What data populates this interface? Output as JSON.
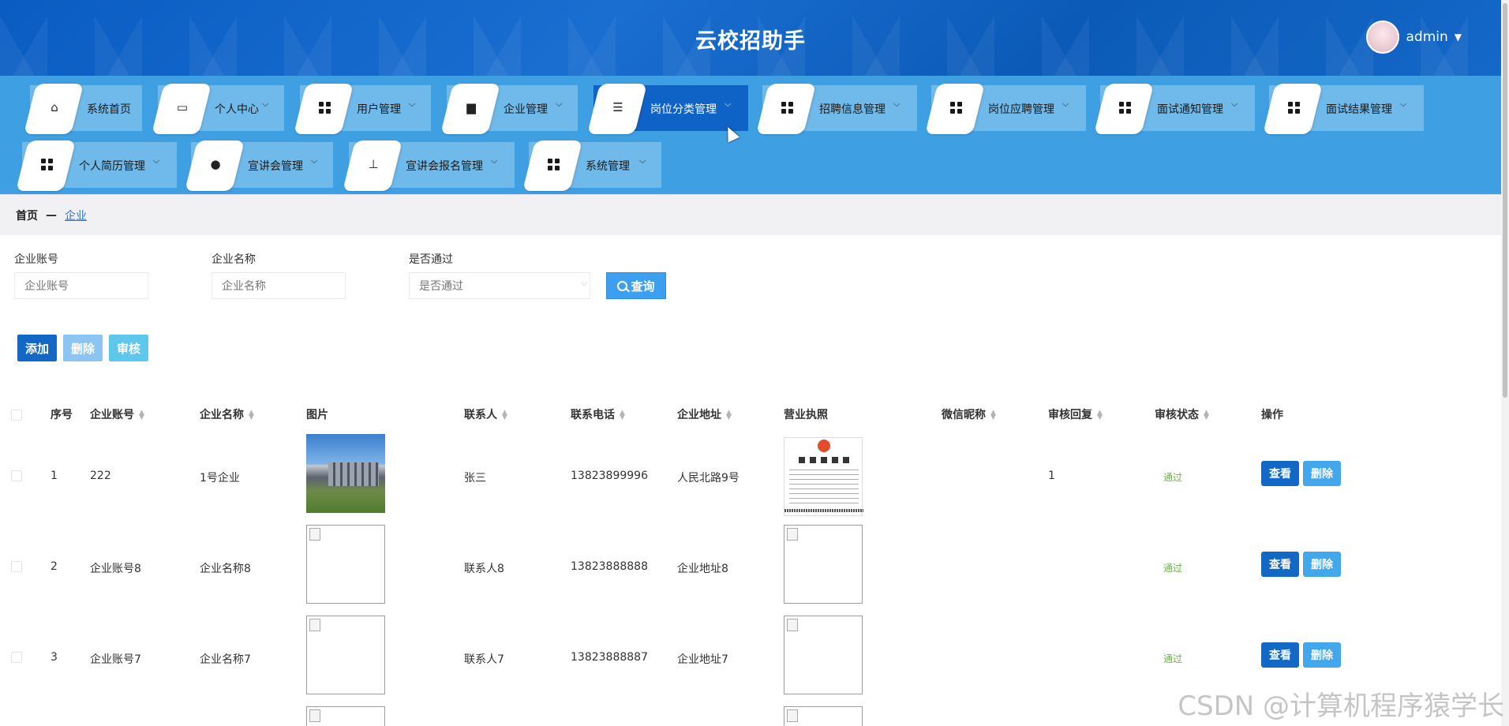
{
  "header": {
    "title": "云校招助手",
    "user_name": "admin"
  },
  "nav": {
    "items": [
      {
        "label": "系统首页",
        "icon": "home-icon",
        "has_dropdown": false,
        "active": false
      },
      {
        "label": "个人中心",
        "icon": "wallet-icon",
        "has_dropdown": true,
        "active": false
      },
      {
        "label": "用户管理",
        "icon": "grid-icon",
        "has_dropdown": true,
        "active": false
      },
      {
        "label": "企业管理",
        "icon": "store-icon",
        "has_dropdown": true,
        "active": false
      },
      {
        "label": "岗位分类管理",
        "icon": "sliders-icon",
        "has_dropdown": true,
        "active": true
      },
      {
        "label": "招聘信息管理",
        "icon": "grid-icon",
        "has_dropdown": true,
        "active": false
      },
      {
        "label": "岗位应聘管理",
        "icon": "grid-icon",
        "has_dropdown": true,
        "active": false
      },
      {
        "label": "面试通知管理",
        "icon": "grid-icon",
        "has_dropdown": true,
        "active": false
      },
      {
        "label": "面试结果管理",
        "icon": "grid-icon",
        "has_dropdown": true,
        "active": false
      },
      {
        "label": "个人简历管理",
        "icon": "grid-icon",
        "has_dropdown": true,
        "active": false
      },
      {
        "label": "宣讲会管理",
        "icon": "user-icon",
        "has_dropdown": true,
        "active": false
      },
      {
        "label": "宣讲会报名管理",
        "icon": "stamp-icon",
        "has_dropdown": true,
        "active": false
      },
      {
        "label": "系统管理",
        "icon": "grid-icon",
        "has_dropdown": true,
        "active": false
      }
    ]
  },
  "breadcrumb": {
    "home": "首页",
    "separator": "—",
    "current": "企业"
  },
  "search": {
    "account_label": "企业账号",
    "account_placeholder": "企业账号",
    "name_label": "企业名称",
    "name_placeholder": "企业名称",
    "passed_label": "是否通过",
    "passed_placeholder": "是否通过",
    "button_label": "查询"
  },
  "actions": {
    "add": "添加",
    "delete": "删除",
    "review": "审核"
  },
  "table": {
    "headers": {
      "index": "序号",
      "account": "企业账号",
      "name": "企业名称",
      "image": "图片",
      "contact": "联系人",
      "phone": "联系电话",
      "address": "企业地址",
      "license": "营业执照",
      "wechat": "微信昵称",
      "reply": "审核回复",
      "status": "审核状态",
      "ops": "操作"
    },
    "rows": [
      {
        "index": "1",
        "account": "222",
        "name": "1号企业",
        "contact": "张三",
        "phone": "13823899996",
        "address": "人民北路9号",
        "wechat": "",
        "reply": "1",
        "status": "通过"
      },
      {
        "index": "2",
        "account": "企业账号8",
        "name": "企业名称8",
        "contact": "联系人8",
        "phone": "13823888888",
        "address": "企业地址8",
        "wechat": "",
        "reply": "",
        "status": "通过"
      },
      {
        "index": "3",
        "account": "企业账号7",
        "name": "企业名称7",
        "contact": "联系人7",
        "phone": "13823888887",
        "address": "企业地址7",
        "wechat": "",
        "reply": "",
        "status": "通过"
      }
    ],
    "view_label": "查看",
    "delete_label": "删除"
  },
  "watermark": "CSDN @计算机程序猿学长",
  "colors": {
    "header_bg": "#0a5cc2",
    "nav_bg": "#3f9fe3",
    "active_nav": "#0f62c6",
    "primary_button": "#1268c4",
    "light_button": "#43a7ec",
    "status_pass": "#6ab04c"
  }
}
